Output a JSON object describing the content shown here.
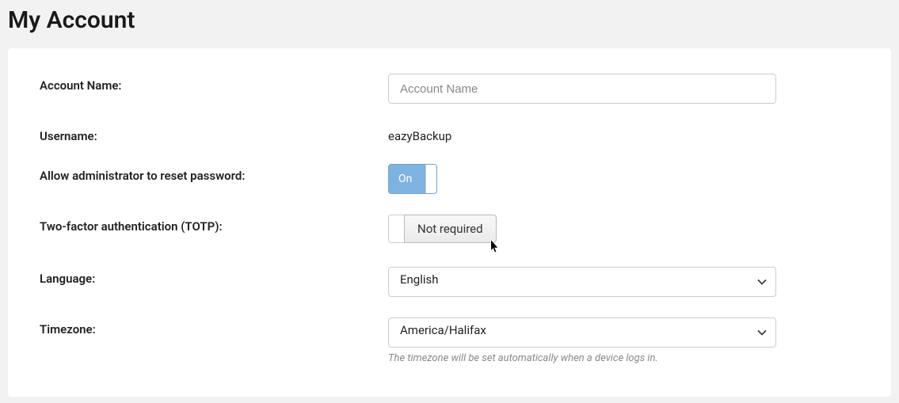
{
  "page": {
    "title": "My Account"
  },
  "form": {
    "accountName": {
      "label": "Account Name:",
      "placeholder": "Account Name",
      "value": ""
    },
    "username": {
      "label": "Username:",
      "value": "eazyBackup"
    },
    "allowAdminReset": {
      "label": "Allow administrator to reset password:",
      "state": "On"
    },
    "totp": {
      "label": "Two-factor authentication (TOTP):",
      "buttonLabel": "Not required"
    },
    "language": {
      "label": "Language:",
      "selected": "English"
    },
    "timezone": {
      "label": "Timezone:",
      "selected": "America/Halifax",
      "help": "The timezone will be set automatically when a device logs in."
    }
  }
}
